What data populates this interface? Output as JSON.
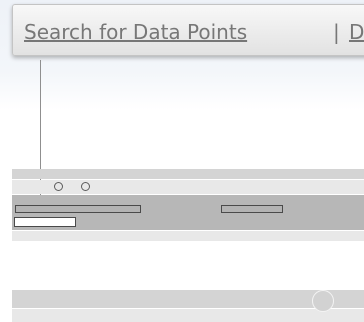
{
  "nav": {
    "items": [
      {
        "label": "Search for Data Points"
      },
      {
        "label": "D"
      }
    ],
    "separator": "|"
  }
}
